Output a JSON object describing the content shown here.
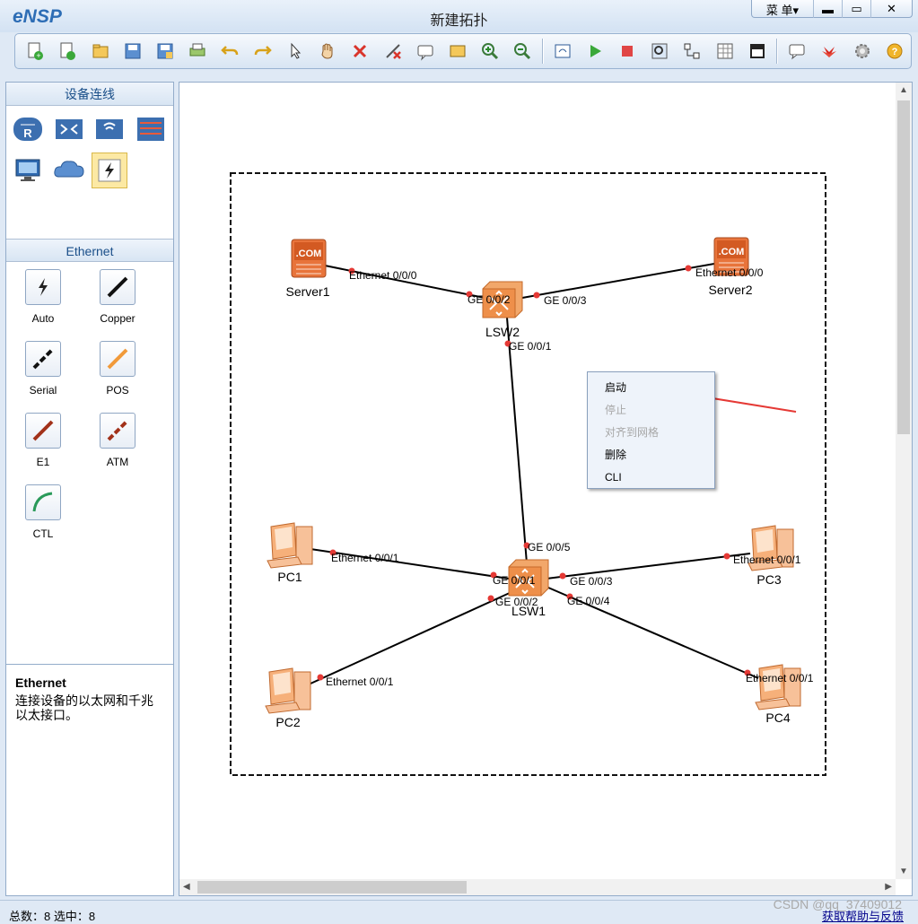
{
  "app": {
    "logo_text": "eNSP",
    "window_title": "新建拓扑"
  },
  "window_buttons": {
    "menu": "菜 单▾",
    "minimize": "▬",
    "maximize": "▭",
    "close": "✕"
  },
  "toolbar": {
    "icons": [
      "new-topology-icon",
      "new-test-icon",
      "open-icon",
      "save-icon",
      "save-as-icon",
      "print-icon",
      "undo-icon",
      "redo-icon",
      "select-icon",
      "pan-icon",
      "delete-icon",
      "delete-link-icon",
      "text-icon",
      "rectangle-icon",
      "zoom-in-icon",
      "zoom-out-icon",
      "fit-icon",
      "start-icon",
      "stop-icon",
      "capture-icon",
      "topology-icon",
      "grid-icon",
      "screenshot-icon",
      "chat-icon",
      "huawei-icon",
      "settings-icon",
      "help-icon"
    ]
  },
  "left_panel": {
    "devices_title": "设备连线",
    "ethernet_title": "Ethernet",
    "cables": [
      "Auto",
      "Copper",
      "Serial",
      "POS",
      "E1",
      "ATM",
      "CTL"
    ],
    "info_title": "Ethernet",
    "info_desc": "连接设备的以太网和千兆以太接口。"
  },
  "topology": {
    "nodes": [
      "Server1",
      "Server2",
      "LSW2",
      "LSW1",
      "PC1",
      "PC2",
      "PC3",
      "PC4"
    ],
    "ports": [
      "Ethernet 0/0/0",
      "GE 0/0/2",
      "GE 0/0/3",
      "Ethernet 0/0/0",
      "GE 0/0/1",
      "GE 0/0/5",
      "Ethernet 0/0/1",
      "GE 0/0/1",
      "GE 0/0/2",
      "GE 0/0/3",
      "GE 0/0/4",
      "Ethernet 0/0/1",
      "Ethernet 0/0/1",
      "Ethernet 0/0/1"
    ]
  },
  "context_menu": {
    "items": [
      "启动",
      "停止",
      "对齐到网格",
      "删除",
      "CLI"
    ]
  },
  "status": {
    "text": "总数：8  选中：8",
    "help_link": "获取帮助与反馈",
    "watermark": "CSDN @qq_37409012"
  },
  "colors": {
    "accent": "#2d6db5",
    "link_dot": "#e53935",
    "arrow": "#e53935",
    "device_orange": "#e8743b"
  }
}
